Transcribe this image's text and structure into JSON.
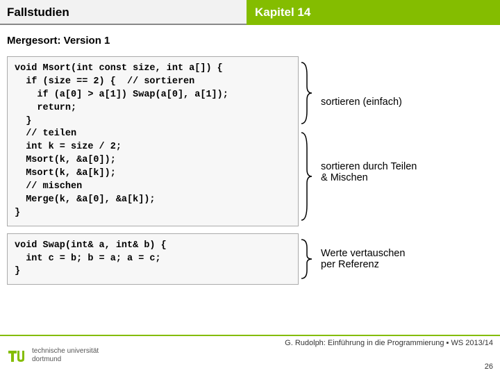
{
  "header": {
    "left": "Fallstudien",
    "right": "Kapitel 14"
  },
  "subtitle": "Mergesort: Version 1",
  "code1": "void Msort(int const size, int a[]) {\n  if (size == 2) {  // sortieren\n    if (a[0] > a[1]) Swap(a[0], a[1]);\n    return;\n  }\n  // teilen\n  int k = size / 2;\n  Msort(k, &a[0]);\n  Msort(k, &a[k]);\n  // mischen\n  Merge(k, &a[0], &a[k]);\n}",
  "annotation1a": "sortieren (einfach)",
  "annotation1b": "sortieren durch Teilen\n& Mischen",
  "code2": "void Swap(int& a, int& b) {\n  int c = b; b = a; a = c;\n}",
  "annotation2": "Werte vertauschen\nper Referenz",
  "footer": {
    "uni1": "technische universität",
    "uni2": "dortmund",
    "credit": "G. Rudolph: Einführung in die Programmierung ▪ WS 2013/14",
    "page": "26"
  }
}
